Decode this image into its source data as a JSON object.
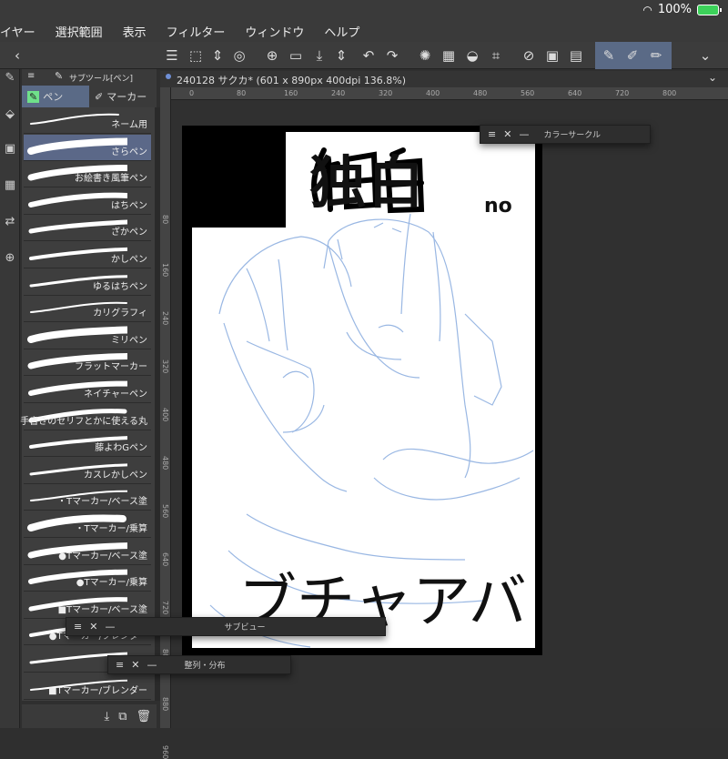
{
  "status": {
    "battery": "100%"
  },
  "menu": [
    "イヤー",
    "選択範囲",
    "表示",
    "フィルター",
    "ウィンドウ",
    "ヘルプ"
  ],
  "subtool": {
    "header": "サブツール[ペン]",
    "tab_pen": "ペン",
    "tab_marker": "マーカー"
  },
  "brushes": [
    {
      "name": "ネーム用",
      "active": false
    },
    {
      "name": "さらペン",
      "active": true
    },
    {
      "name": "お絵書き風筆ペン",
      "active": false
    },
    {
      "name": "はちペン",
      "active": false
    },
    {
      "name": "ざかペン",
      "active": false
    },
    {
      "name": "かしペン",
      "active": false
    },
    {
      "name": "ゆるはちペン",
      "active": false
    },
    {
      "name": "カリグラフィ",
      "active": false
    },
    {
      "name": "ミリペン",
      "active": false
    },
    {
      "name": "フラットマーカー",
      "active": false
    },
    {
      "name": "ネイチャーペン",
      "active": false
    },
    {
      "name": "手書きのセリフとかに使える丸",
      "active": false
    },
    {
      "name": "藤よわGペン",
      "active": false
    },
    {
      "name": "カスレかしペン",
      "active": false
    },
    {
      "name": "・Tマーカー/ベース塗",
      "active": false
    },
    {
      "name": "・Tマーカー/乗算",
      "active": false
    },
    {
      "name": "●Tマーカー/ベース塗",
      "active": false
    },
    {
      "name": "●Tマーカー/乗算",
      "active": false
    },
    {
      "name": "■Tマーカー/ベース塗",
      "active": false
    },
    {
      "name": "●Tマーカー/ブレンダー",
      "active": false
    },
    {
      "name": "■Tマー",
      "active": false
    },
    {
      "name": "■Tマーカー/ブレンダー",
      "active": false
    }
  ],
  "document": {
    "tab_title": "240128 サクカ* (601 x 890px 400dpi 136.8%)"
  },
  "ruler_top": [
    "0",
    "80",
    "160",
    "240",
    "320",
    "400",
    "480",
    "560",
    "640",
    "720",
    "800"
  ],
  "ruler_left": [
    "80",
    "160",
    "240",
    "320",
    "400",
    "480",
    "560",
    "640",
    "720",
    "800",
    "880",
    "960"
  ],
  "panels": {
    "color_circle": "カラーサークル",
    "sub_view": "サブビュー",
    "align": "整列・分布"
  },
  "canvas_text": {
    "title": "独白",
    "title_suffix": "no",
    "bottom": "ブチャアバ"
  },
  "colors": {
    "accent": "#5a6a86",
    "sketch": "#8fb0e0",
    "green": "#3cd25a"
  }
}
